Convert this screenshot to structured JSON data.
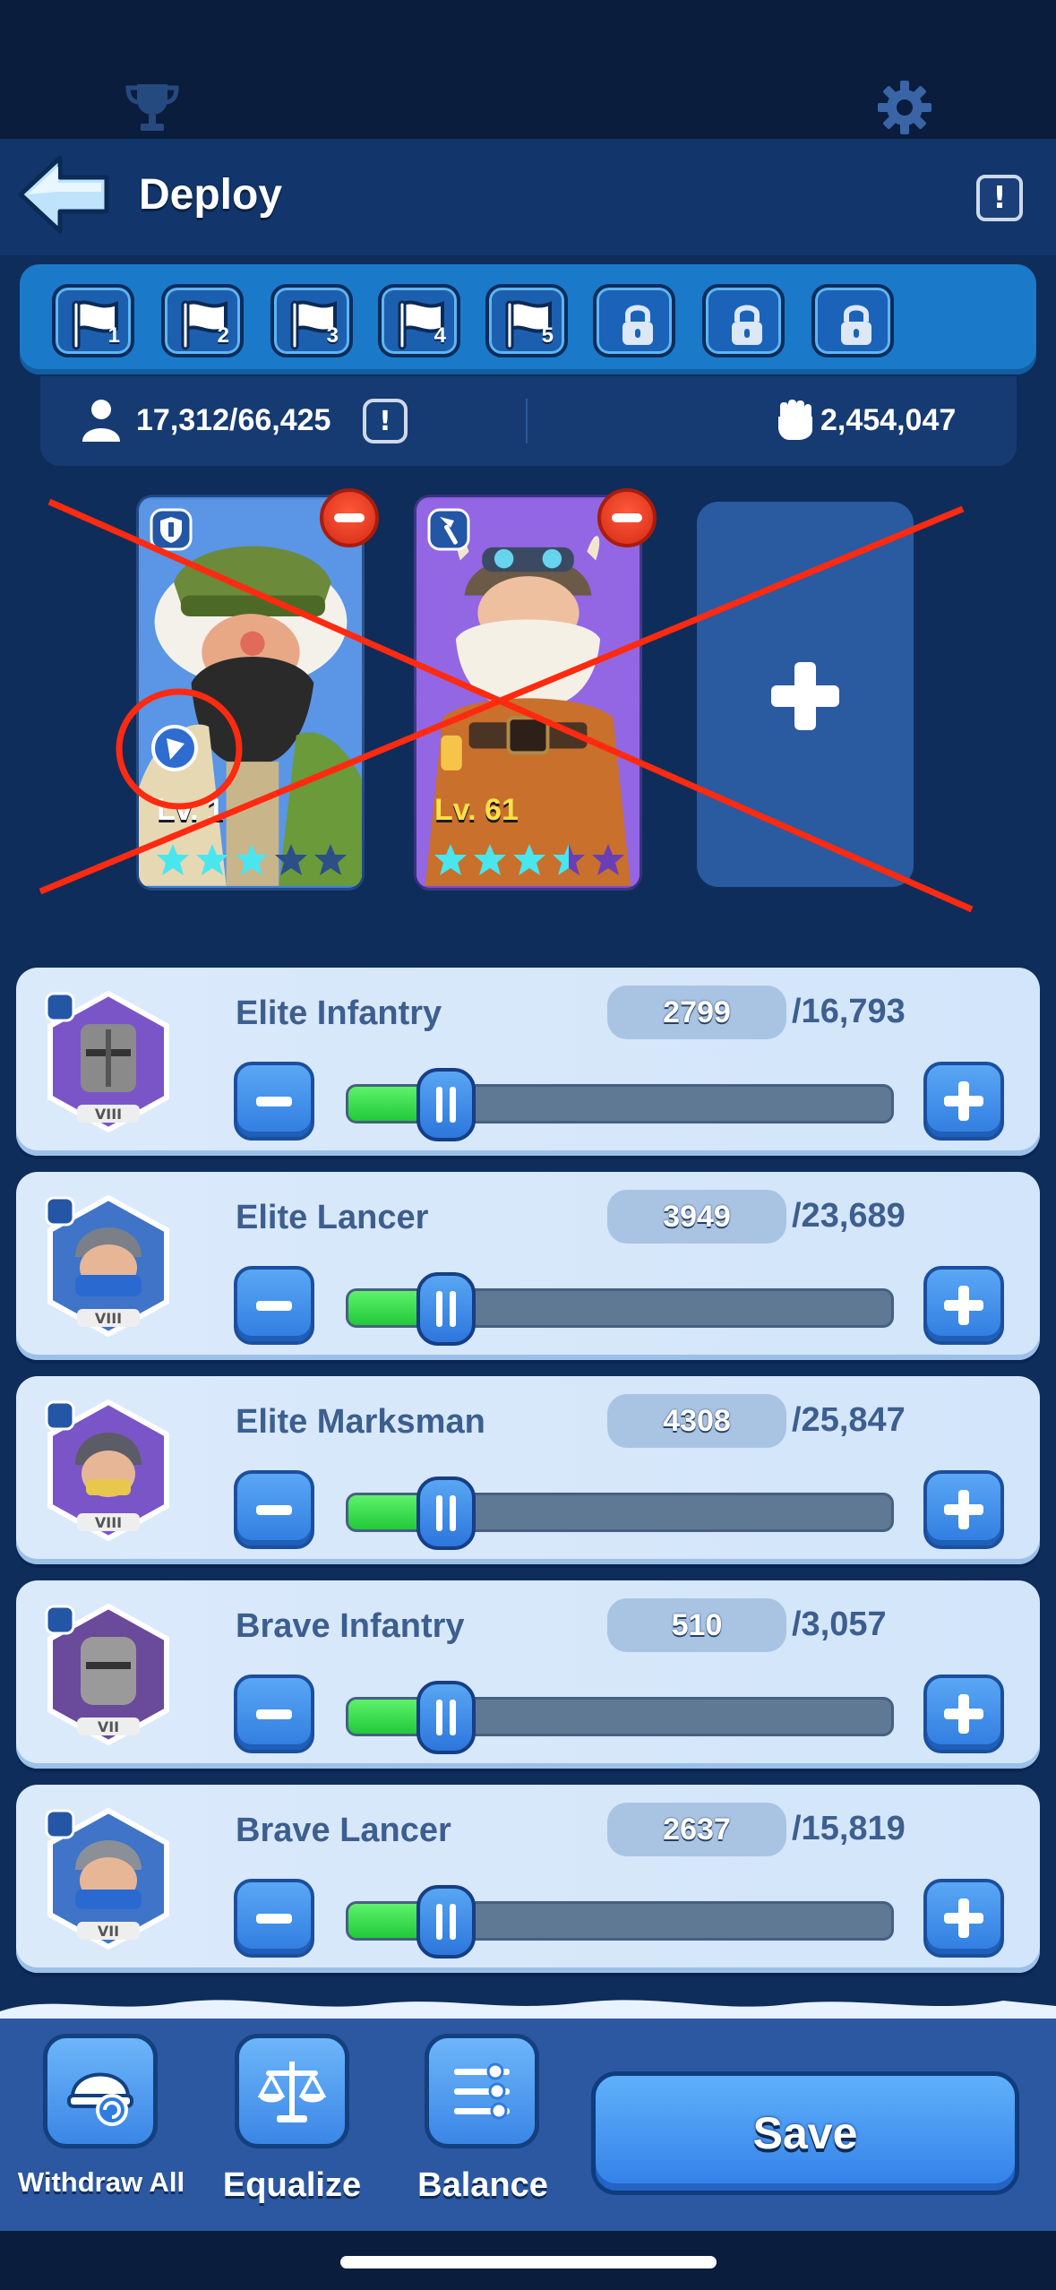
{
  "header": {
    "title": "Deploy",
    "info_symbol": "!"
  },
  "formation_tabs": [
    {
      "number": "1",
      "locked": false
    },
    {
      "number": "2",
      "locked": false
    },
    {
      "number": "3",
      "locked": false
    },
    {
      "number": "4",
      "locked": false
    },
    {
      "number": "5",
      "locked": false
    },
    {
      "number": "",
      "locked": true
    },
    {
      "number": "",
      "locked": true
    },
    {
      "number": "",
      "locked": true
    }
  ],
  "stats": {
    "capacity": "17,312/66,425",
    "capacity_info_symbol": "!",
    "power": "2,454,047"
  },
  "heroes": [
    {
      "level_label": "Lv. 1",
      "stars_filled": 3,
      "stars_total": 5,
      "type_icon": "shield-icon",
      "rarity_color": "#4d8ae0"
    },
    {
      "level_label": "Lv. 61",
      "stars_filled": 3.5,
      "stars_total": 5,
      "type_icon": "lance-icon",
      "rarity_color": "#8a5fe0"
    }
  ],
  "troops": [
    {
      "name": "Elite Infantry",
      "count": "2799",
      "max": "/16,793",
      "tier": "VIII",
      "type_icon": "shield-icon",
      "fill_fraction": 0.17
    },
    {
      "name": "Elite Lancer",
      "count": "3949",
      "max": "/23,689",
      "tier": "VIII",
      "type_icon": "lance-icon",
      "fill_fraction": 0.17
    },
    {
      "name": "Elite Marksman",
      "count": "4308",
      "max": "/25,847",
      "tier": "VIII",
      "type_icon": "bow-icon",
      "fill_fraction": 0.17
    },
    {
      "name": "Brave Infantry",
      "count": "510",
      "max": "/3,057",
      "tier": "VII",
      "type_icon": "shield-icon",
      "fill_fraction": 0.17
    },
    {
      "name": "Brave Lancer",
      "count": "2637",
      "max": "/15,819",
      "tier": "VII",
      "type_icon": "lance-icon",
      "fill_fraction": 0.17
    }
  ],
  "actions": {
    "withdraw_label": "Withdraw All",
    "equalize_label": "Equalize",
    "balance_label": "Balance",
    "save_label": "Save"
  },
  "colors": {
    "accent": "#3280e8",
    "annotation_red": "#ff2a10",
    "slider_green": "#22c93a"
  }
}
